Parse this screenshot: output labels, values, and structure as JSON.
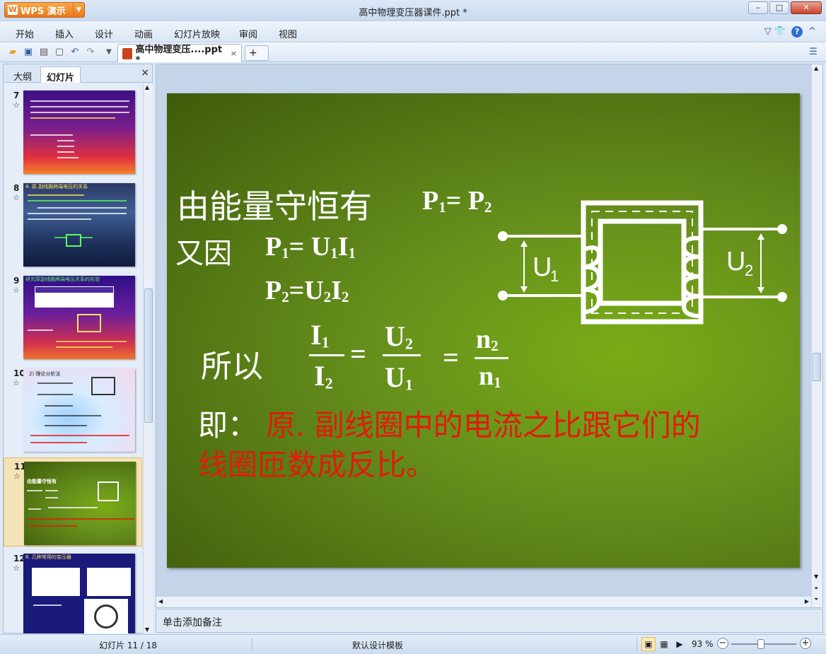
{
  "app": {
    "name": "WPS 演示",
    "logo_glyph": "W",
    "window_title": "高中物理变压器课件.ppt *"
  },
  "window_controls": {
    "minimize": "–",
    "maximize": "□",
    "close": "✕"
  },
  "menu": [
    "开始",
    "插入",
    "设计",
    "动画",
    "幻灯片放映",
    "审阅",
    "视图"
  ],
  "menu_right": {
    "skin": "▽ 👕",
    "help": "?"
  },
  "toolbar": {
    "icons": [
      "open-icon",
      "save-icon",
      "print-icon",
      "preview-icon",
      "undo-icon",
      "redo-icon",
      "customize-icon"
    ],
    "doc_tab": "高中物理变压....ppt *",
    "tab_close": "×",
    "new_tab": "+"
  },
  "left_panel": {
    "tabs": [
      "大纲",
      "幻灯片"
    ],
    "close": "×",
    "thumbnails": [
      {
        "number": "7",
        "star": "☆",
        "title": ""
      },
      {
        "number": "8",
        "star": "☆",
        "title": "4. 原.副线圈两端电压的关系"
      },
      {
        "number": "9",
        "star": "☆",
        "title": "研究原副线圈两端电压关系的实验"
      },
      {
        "number": "10",
        "star": "☆",
        "title": "2) 理论分析法"
      },
      {
        "number": "11",
        "star": "☆",
        "title": "由能量守恒有"
      },
      {
        "number": "12",
        "star": "☆",
        "title": "6. 几种常用的变压器"
      }
    ]
  },
  "slide": {
    "line1": "由能量守恒有",
    "eq1": "P<sub>1</sub>= P<sub>2</sub>",
    "line2": "又因",
    "eq2": "P<sub>1</sub>= U<sub>1</sub>I<sub>1</sub>",
    "eq3": "P<sub>2</sub>=U<sub>2</sub>I<sub>2</sub>",
    "line3": "所以",
    "frac1_num": "I<sub>1</sub>",
    "frac1_den": "I<sub>2</sub>",
    "equals1": "=",
    "frac2_num": "U<sub>2</sub>",
    "frac2_den": "U<sub>1</sub>",
    "equals2": "=",
    "frac3_num": "n<sub>2</sub>",
    "frac3_den": "n<sub>1</sub>",
    "conclusion_prefix": "即：",
    "conclusion_red_1": "原. 副线圈中的电流之比跟它们的",
    "conclusion_red_2": "线圈匝数成反比。",
    "label_u1": "U",
    "label_u1_sub": "1",
    "label_u2": "U",
    "label_u2_sub": "2"
  },
  "notes": {
    "placeholder": "单击添加备注"
  },
  "status": {
    "slide_info": "幻灯片 11 / 18",
    "template": "默认设计模板",
    "zoom": "93 %",
    "zoom_minus": "−",
    "zoom_plus": "+"
  },
  "colors": {
    "accent_orange": "#e9781b",
    "slide_green": "#66901c",
    "conclusion_red": "#e31a0c"
  }
}
